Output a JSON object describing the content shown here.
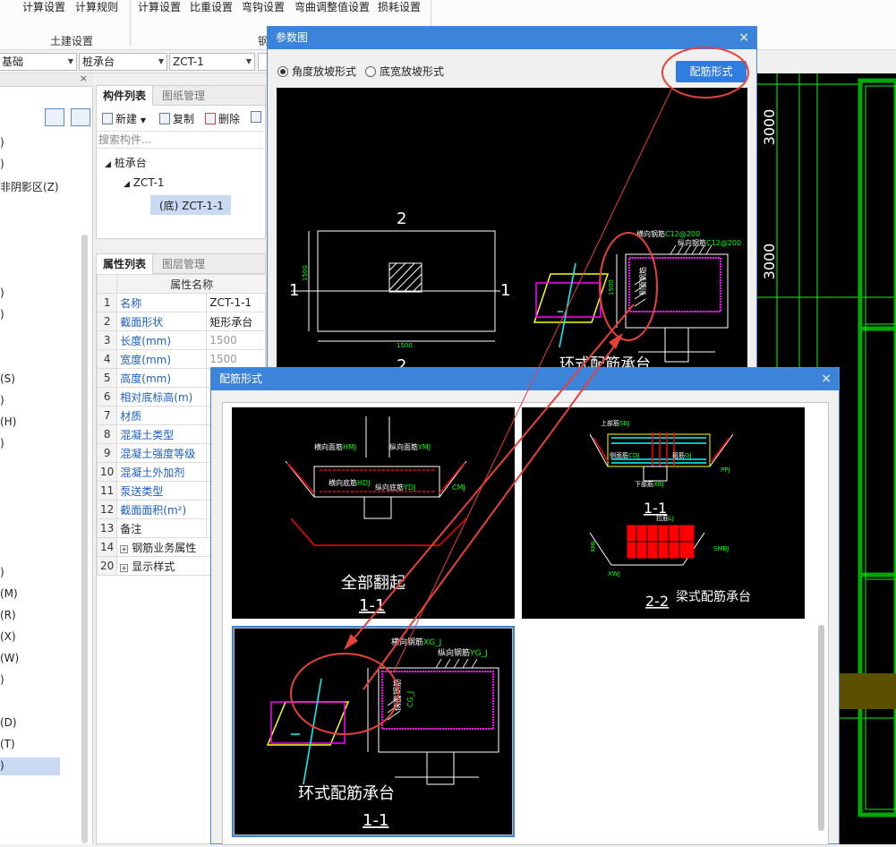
{
  "ribbon": {
    "items": [
      "计算设置",
      "计算规则",
      "计算设置",
      "比重设置",
      "弯钩设置",
      "弯曲调整值设置",
      "损耗设置"
    ],
    "group_label": "土建设置",
    "group_label2": "钢"
  },
  "selectors": {
    "s1": "基础",
    "s2": "桩承台",
    "s3": "ZCT-1"
  },
  "left_panel": {
    "items": [
      ")",
      ")",
      "非阴影区(Z)",
      ")",
      ")",
      "(S)",
      ")",
      "(H)",
      ")",
      ")",
      "(M)",
      "(R)",
      "(X)",
      "(W)",
      ")",
      "(D)",
      "(T)",
      ")"
    ]
  },
  "component_list": {
    "tab_active": "构件列表",
    "tab_inactive": "图纸管理",
    "btn_new": "新建",
    "btn_copy": "复制",
    "btn_delete": "删除",
    "search_placeholder": "搜索构件...",
    "tree": {
      "root": "桩承台",
      "child": "ZCT-1",
      "leaf": "(底) ZCT-1-1"
    }
  },
  "property_list": {
    "tab_active": "属性列表",
    "tab_inactive": "图层管理",
    "header": "属性名称",
    "rows": [
      {
        "idx": "1",
        "name": "名称",
        "value": "ZCT-1-1"
      },
      {
        "idx": "2",
        "name": "截面形状",
        "value": "矩形承台"
      },
      {
        "idx": "3",
        "name": "长度(mm)",
        "value": "1500"
      },
      {
        "idx": "4",
        "name": "宽度(mm)",
        "value": "1500"
      },
      {
        "idx": "5",
        "name": "高度(mm)",
        "value": ""
      },
      {
        "idx": "6",
        "name": "相对底标高(m)",
        "value": ""
      },
      {
        "idx": "7",
        "name": "材质",
        "value": ""
      },
      {
        "idx": "8",
        "name": "混凝土类型",
        "value": ""
      },
      {
        "idx": "9",
        "name": "混凝土强度等级",
        "value": ""
      },
      {
        "idx": "10",
        "name": "混凝土外加剂",
        "value": ""
      },
      {
        "idx": "11",
        "name": "泵送类型",
        "value": ""
      },
      {
        "idx": "12",
        "name": "截面面积(m²)",
        "value": ""
      },
      {
        "idx": "13",
        "name": "备注",
        "value": ""
      },
      {
        "idx": "14",
        "name": "钢筋业务属性",
        "value": ""
      },
      {
        "idx": "20",
        "name": "显示样式",
        "value": ""
      }
    ]
  },
  "param_dialog": {
    "title": "参数图",
    "close": "×",
    "radio1": "角度放坡形式",
    "radio2": "底宽放坡形式",
    "button": "配筋形式",
    "drawing": {
      "sec2_top": "2",
      "sec2_bot": "2",
      "sec1_left": "1",
      "sec1_right": "1",
      "dim_h": "1500",
      "dim_v": "1500",
      "label_h": "横向钢筋",
      "label_h_val": "C12@200",
      "label_v": "纵向钢筋",
      "label_v_val": "C12@200",
      "side_label": "侧面钢筋",
      "dim_right": "1500",
      "title": "环式配筋承台"
    }
  },
  "rebar_dialog": {
    "title": "配筋形式",
    "close": "×",
    "t1": {
      "title": "全部翻起",
      "section": "1-1",
      "lbl_hm": "横向面筋",
      "lbl_hm_code": "HMJ",
      "lbl_zm": "纵向面筋",
      "lbl_zm_code": "YMJ",
      "lbl_hd": "横向底筋",
      "lbl_hd_code": "HDJ",
      "lbl_zd": "纵向底筋",
      "lbl_zd_code": "YDJ",
      "lbl_cmj": "CMJ"
    },
    "t2": {
      "title": "梁式配筋承台",
      "section1": "1-1",
      "section2": "2-2",
      "lbl_top": "上部筋",
      "lbl_top_code": "SBJ",
      "lbl_bot": "下部筋",
      "lbl_bot_code": "XBJ",
      "lbl_side": "侧面筋",
      "lbl_side_code": "CDJ",
      "lbl_gj": "箍筋",
      "lbl_gj_code": "GJ",
      "lbl_lj": "拉筋",
      "lbl_lj_code": "LJ",
      "lbl_ppj": "PPJ",
      "lbl_xwj": "XWJ",
      "lbl_xmj": "XMJ",
      "lbl_smbj": "SMBJ"
    },
    "t3": {
      "title": "环式配筋承台",
      "section": "1-1",
      "lbl_h": "横向钢筋",
      "lbl_h_code": "XG_J",
      "lbl_v": "纵向钢筋",
      "lbl_v_code": "YG_J",
      "side_label": "侧面钢筋",
      "side_code": "CG_J"
    }
  },
  "drawing_right": {
    "dim1": "3000",
    "dim2": "3000"
  },
  "colors": {
    "title_bar": "#3c84da",
    "annotation": "#e8413b",
    "cad_green": "#00ff00",
    "cad_magenta": "#ff00ff",
    "cad_yellow": "#ffff00",
    "cad_cyan": "#00ffff"
  }
}
